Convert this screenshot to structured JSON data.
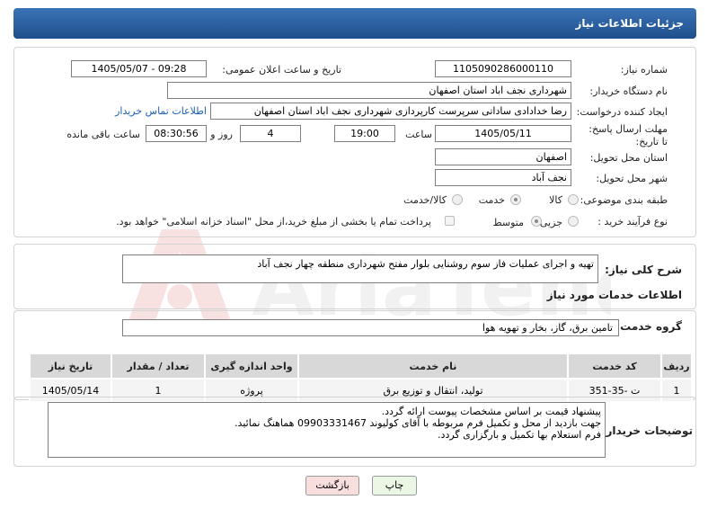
{
  "header": {
    "title": "جزئیات اطلاعات نیاز"
  },
  "fields": {
    "need_number_label": "شماره نیاز:",
    "need_number": "1105090286000110",
    "announce_label": "تاریخ و ساعت اعلان عمومی:",
    "announce_value": "1405/05/07 - 09:28",
    "buyer_org_label": "نام دستگاه خریدار:",
    "buyer_org": "شهرداری نجف اباد استان اصفهان",
    "creator_label": "ایجاد کننده درخواست:",
    "creator": "رضا خدادادی ساداتی سرپرست  کارپردازی شهرداری نجف اباد استان اصفهان",
    "contact_link": "اطلاعات تماس خریدار",
    "deadline_label": "مهلت ارسال پاسخ: تا تاریخ:",
    "deadline_date": "1405/05/11",
    "time_label": "ساعت",
    "deadline_time": "19:00",
    "days_value": "4",
    "days_label": "روز و",
    "remaining_time": "08:30:56",
    "remaining_label": "ساعت باقی مانده",
    "province_label": "استان محل تحویل:",
    "province": "اصفهان",
    "city_label": "شهر محل تحویل:",
    "city": "نجف آباد",
    "category_label": "طبقه بندی موضوعی:",
    "category_options": [
      "کالا",
      "خدمت",
      "کالا/خدمت"
    ],
    "process_label": "نوع فرآیند خرید :",
    "process_options": [
      "جزیی",
      "متوسط"
    ],
    "payment_note": "پرداخت تمام یا بخشی از مبلغ خرید،از محل \"اسناد خزانه اسلامی\" خواهد بود."
  },
  "summary": {
    "label": "شرح کلی نیاز:",
    "text": "تهیه و اجرای عملیات فاز سوم روشنایی بلوار مفتح شهرداری منطقه چهار نجف آباد"
  },
  "services": {
    "section_title": "اطلاعات خدمات مورد نیاز",
    "group_label": "گروه خدمت:",
    "group_value": "تامین برق، گاز، بخار و تهویه هوا",
    "columns": [
      "ردیف",
      "کد خدمت",
      "نام خدمت",
      "واحد اندازه گیری",
      "تعداد / مقدار",
      "تاریخ نیاز"
    ],
    "rows": [
      [
        "1",
        "ت -35-351",
        "تولید، انتقال و توزیع برق",
        "پروژه",
        "1",
        "1405/05/14"
      ]
    ]
  },
  "buyer_notes": {
    "label": "توضیحات خریدار:",
    "lines": [
      "پیشنهاد قیمت بر اساس مشخصات پیوست ارائه گردد.",
      "جهت بازدید از محل و تکمیل فرم مربوطه با آقای کولیوند 09903331467 هماهنگ نمائید.",
      "فرم استعلام بها تکمیل و بارگزاری گردد."
    ]
  },
  "buttons": {
    "print": "چاپ",
    "back": "بازگشت"
  },
  "colors": {
    "header": "#2a62a6",
    "back_button": "#f9dede",
    "print_button": "#eaf7e4"
  }
}
